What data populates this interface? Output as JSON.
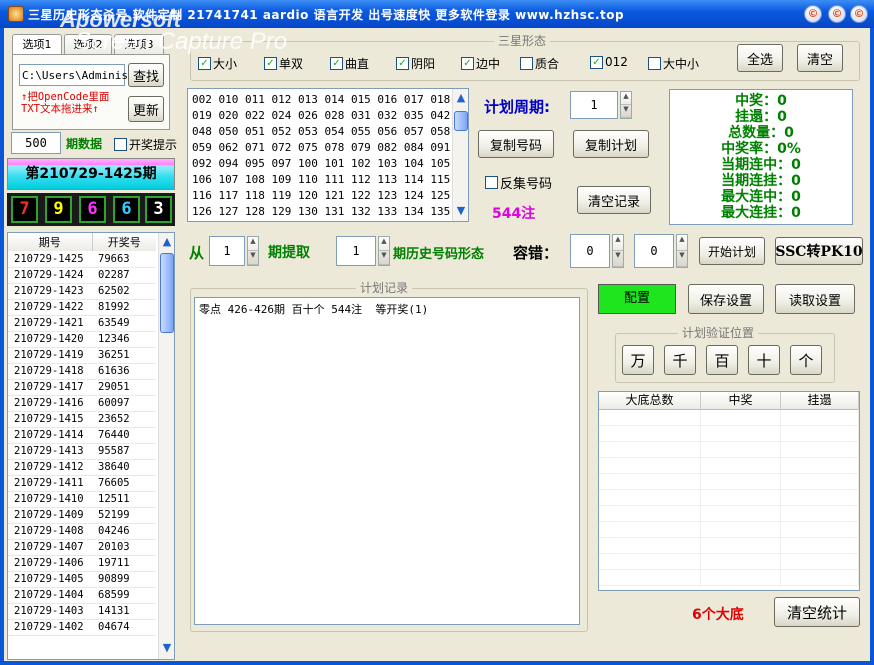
{
  "window": {
    "title": "三星历史形态杀号  软件定制 21741741 aardio 语言开发 出号速度快 更多软件登录 www.hzhsc.top",
    "watermark_line1": "Apowersoft",
    "watermark_line2": "Screen Capture Pro",
    "buttons": [
      "©",
      "©",
      "©"
    ]
  },
  "left": {
    "tabs": [
      "选项1",
      "选项2",
      "选项3"
    ],
    "path_value": "C:\\Users\\Administ",
    "find_button": "查找",
    "update_button": "更新",
    "hint_line1": "↑把OpenCode里面",
    "hint_line2": "TXT文本拖进来↑",
    "count_value": "500",
    "count_label": "期数据",
    "prize_hint_label": "开奖提示",
    "period_banner": "第210729-1425期",
    "digits": [
      {
        "value": "7",
        "color": "#ff2a2a"
      },
      {
        "value": "9",
        "color": "#ffff00"
      },
      {
        "value": "6",
        "color": "#ff33ff"
      },
      {
        "value": "6",
        "color": "#33ccff"
      },
      {
        "value": "3",
        "color": "#ffffff"
      }
    ],
    "history_headers": [
      "期号",
      "开奖号"
    ],
    "history_rows": [
      [
        "210729-1425",
        "79663"
      ],
      [
        "210729-1424",
        "02287"
      ],
      [
        "210729-1423",
        "62502"
      ],
      [
        "210729-1422",
        "81992"
      ],
      [
        "210729-1421",
        "63549"
      ],
      [
        "210729-1420",
        "12346"
      ],
      [
        "210729-1419",
        "36251"
      ],
      [
        "210729-1418",
        "61636"
      ],
      [
        "210729-1417",
        "29051"
      ],
      [
        "210729-1416",
        "60097"
      ],
      [
        "210729-1415",
        "23652"
      ],
      [
        "210729-1414",
        "76440"
      ],
      [
        "210729-1413",
        "95587"
      ],
      [
        "210729-1412",
        "38640"
      ],
      [
        "210729-1411",
        "76605"
      ],
      [
        "210729-1410",
        "12511"
      ],
      [
        "210729-1409",
        "52199"
      ],
      [
        "210729-1408",
        "04246"
      ],
      [
        "210729-1407",
        "20103"
      ],
      [
        "210729-1406",
        "19711"
      ],
      [
        "210729-1405",
        "90899"
      ],
      [
        "210729-1404",
        "68599"
      ],
      [
        "210729-1403",
        "14131"
      ],
      [
        "210729-1402",
        "04674"
      ]
    ]
  },
  "shape": {
    "legend": "三星形态",
    "options": [
      {
        "label": "大小",
        "checked": true
      },
      {
        "label": "单双",
        "checked": true
      },
      {
        "label": "曲直",
        "checked": true
      },
      {
        "label": "阴阳",
        "checked": true
      },
      {
        "label": "边中",
        "checked": true
      },
      {
        "label": "质合",
        "checked": false
      },
      {
        "label": "012",
        "checked": true
      },
      {
        "label": "大中小",
        "checked": false
      }
    ],
    "select_all_button": "全选",
    "clear_button": "清空"
  },
  "numbers": {
    "lines": [
      "002 010 011 012 013 014 015 016 017 018",
      "019 020 022 024 026 028 031 032 035 042",
      "048 050 051 052 053 054 055 056 057 058",
      "059 062 071 072 075 078 079 082 084 091",
      "092 094 095 097 100 101 102 103 104 105",
      "106 107 108 109 110 111 112 113 114 115",
      "116 117 118 119 120 121 122 123 124 125",
      "126 127 128 129 130 131 132 133 134 135"
    ]
  },
  "plan": {
    "cycle_label": "计划周期:",
    "cycle_value": "1",
    "copy_numbers_button": "复制号码",
    "copy_plan_button": "复制计划",
    "reverse_label": "反集号码",
    "clear_record_button": "清空记录",
    "count_label": "544注"
  },
  "stats": {
    "lines": [
      "中奖：0",
      "挂遢：0",
      "总数量：0",
      "中奖率：0%",
      "当期连中：0",
      "当期连挂：0",
      "最大连中：0",
      "最大连挂：0"
    ]
  },
  "extract": {
    "from_label": "从",
    "from_value": "1",
    "period_extract_label": "期提取",
    "hist_value": "1",
    "hist_label": "期历史号码形态",
    "tolerance_label": "容错：",
    "tol_value1": "0",
    "tol_value2": "0",
    "start_plan_button": "开始计划",
    "ssc_button": "SSC转PK10"
  },
  "record": {
    "legend": "计划记录",
    "content": "零点 426-426期 百十个 544注  等开奖(1)"
  },
  "config": {
    "config_button": "配置",
    "save_button": "保存设置",
    "read_button": "读取设置",
    "verify_legend": "计划验证位置",
    "positions": [
      "万",
      "千",
      "百",
      "十",
      "个"
    ]
  },
  "bottom_table": {
    "headers": [
      "大底总数",
      "中奖",
      "挂遢"
    ],
    "dadi_label": "6个大底",
    "clear_stats_button": "清空统计"
  }
}
